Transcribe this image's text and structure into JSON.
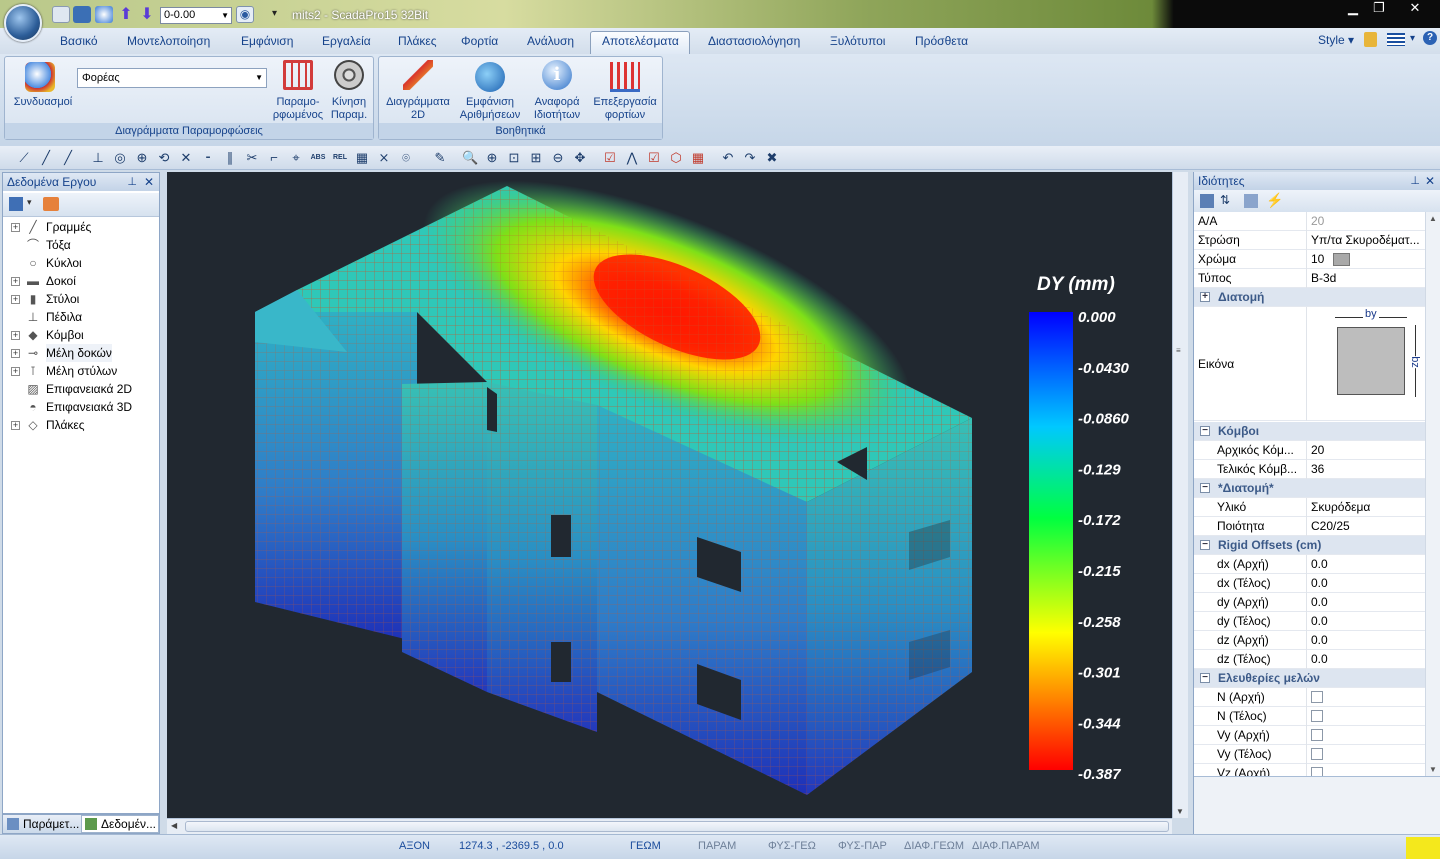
{
  "title_bar": {
    "window_title": "mits2 - ScadaPro15 32Bit",
    "qat_combo_value": "0-0.00"
  },
  "ribbon": {
    "tabs": [
      "Βασικό",
      "Μοντελοποίηση",
      "Εμφάνιση",
      "Εργαλεία",
      "Πλάκες",
      "Φορτία",
      "Ανάλυση",
      "Αποτελέσματα",
      "Διαστασιολόγηση",
      "Ξυλότυποι",
      "Πρόσθετα"
    ],
    "active_tab": "Αποτελέσματα",
    "style_label": "Style",
    "group_deform": {
      "label": "Διαγράμματα Παραμορφώσεις",
      "combinations": "Συνδυασμοί",
      "combo_value": "Φορέας",
      "deformed_line1": "Παραμο-",
      "deformed_line2": "ρφωμένος",
      "motion_line1": "Κίνηση",
      "motion_line2": "Παραμ."
    },
    "group_aux": {
      "label": "Βοηθητικά",
      "diagrams_line1": "Διαγράμματα",
      "diagrams_line2": "2D",
      "numbering_line1": "Εμφάνιση",
      "numbering_line2": "Αριθμήσεων",
      "report_line1": "Αναφορά",
      "report_line2": "Ιδιοτήτων",
      "loads_line1": "Επεξεργασία",
      "loads_line2": "φορτίων"
    }
  },
  "toolbar": {
    "icons": [
      "polyline-icon",
      "line-icon",
      "line-icon",
      "perpendicular-icon",
      "circle-icon",
      "target-icon",
      "rotate-icon",
      "cross-icon",
      "dash-icon",
      "parallel-icon",
      "trim-icon",
      "corner-icon",
      "snap-icon",
      "abs-icon",
      "rel-icon",
      "grid-icon",
      "break-icon",
      "pin-icon",
      "pencil-icon",
      "zoom-icon",
      "zoom-in-icon",
      "zoom-window-icon",
      "zoom-extents-icon",
      "zoom-out-icon",
      "pan-icon",
      "check-icon",
      "chart-icon",
      "check-icon",
      "cube-icon",
      "table-icon",
      "undo-icon",
      "redo-icon",
      "delete-icon"
    ],
    "abs_text": "ABS",
    "rel_text": "REL"
  },
  "left_panel": {
    "title": "Δεδομένα Εργου",
    "tree": [
      {
        "label": "Γραμμές",
        "icon": "line-icon",
        "expandable": true
      },
      {
        "label": "Τόξα",
        "icon": "arc-icon",
        "expandable": false
      },
      {
        "label": "Κύκλοι",
        "icon": "circle-icon",
        "expandable": false
      },
      {
        "label": "Δοκοί",
        "icon": "beam-icon",
        "expandable": true
      },
      {
        "label": "Στύλοι",
        "icon": "column-icon",
        "expandable": true
      },
      {
        "label": "Πέδιλα",
        "icon": "footing-icon",
        "expandable": false
      },
      {
        "label": "Κόμβοι",
        "icon": "node-icon",
        "expandable": true
      },
      {
        "label": "Μέλη δοκών",
        "icon": "beam-member-icon",
        "expandable": true
      },
      {
        "label": "Μέλη στύλων",
        "icon": "column-member-icon",
        "expandable": true
      },
      {
        "label": "Επιφανειακά 2D",
        "icon": "surface-2d-icon",
        "expandable": false
      },
      {
        "label": "Επιφανειακά 3D",
        "icon": "surface-3d-icon",
        "expandable": false
      },
      {
        "label": "Πλάκες",
        "icon": "slab-icon",
        "expandable": true
      }
    ],
    "bottom_tabs": [
      "Παράμετ...",
      "Δεδομέν..."
    ]
  },
  "viewport": {
    "legend_title": "DY (mm)",
    "legend_values": [
      "0.000",
      "-0.0430",
      "-0.0860",
      "-0.129",
      "-0.172",
      "-0.215",
      "-0.258",
      "-0.301",
      "-0.344",
      "-0.387"
    ],
    "colors": {
      "background": "#212830",
      "max": "#0000ff",
      "min": "#ff0000"
    }
  },
  "right_panel": {
    "title": "Ιδιότητες",
    "rows": [
      {
        "type": "row",
        "key": "Α/Α",
        "value": "20",
        "dim": true
      },
      {
        "type": "row",
        "key": "Στρώση",
        "value": "Υπ/τα Σκυροδέματ..."
      },
      {
        "type": "row",
        "key": "Χρώμα",
        "value": "10",
        "swatch": "#a9a9a9"
      },
      {
        "type": "row",
        "key": "Τύπος",
        "value": "B-3d"
      },
      {
        "type": "cat",
        "key": "Διατομή",
        "sign": "+"
      },
      {
        "type": "image",
        "key": "Εικόνα",
        "by": "by",
        "bz": "bz"
      },
      {
        "type": "cat",
        "key": "Κόμβοι",
        "sign": "−"
      },
      {
        "type": "sub",
        "key": "Αρχικός Κόμ...",
        "value": "20"
      },
      {
        "type": "sub",
        "key": "Τελικός Κόμβ...",
        "value": "36"
      },
      {
        "type": "cat",
        "key": "*Διατομή*",
        "sign": "−"
      },
      {
        "type": "sub",
        "key": "Υλικό",
        "value": "Σκυρόδεμα"
      },
      {
        "type": "sub",
        "key": "Ποιότητα",
        "value": "C20/25"
      },
      {
        "type": "cat",
        "key": "Rigid Offsets (cm)",
        "sign": "−"
      },
      {
        "type": "sub",
        "key": "dx (Αρχή)",
        "value": "0.0"
      },
      {
        "type": "sub",
        "key": "dx (Τέλος)",
        "value": "0.0"
      },
      {
        "type": "sub",
        "key": "dy (Αρχή)",
        "value": "0.0"
      },
      {
        "type": "sub",
        "key": "dy (Τέλος)",
        "value": "0.0"
      },
      {
        "type": "sub",
        "key": "dz (Αρχή)",
        "value": "0.0"
      },
      {
        "type": "sub",
        "key": "dz (Τέλος)",
        "value": "0.0"
      },
      {
        "type": "cat",
        "key": "Ελευθερίες μελών",
        "sign": "−"
      },
      {
        "type": "check",
        "key": "N (Αρχή)"
      },
      {
        "type": "check",
        "key": "N (Τέλος)"
      },
      {
        "type": "check",
        "key": "Vy (Αρχή)"
      },
      {
        "type": "check",
        "key": "Vy (Τέλος)"
      },
      {
        "type": "check",
        "key": "Vz (Αρχή)"
      }
    ]
  },
  "status_bar": {
    "axon": "ΑΞΟΝ",
    "coords": "1274.3 , -2369.5 , 0.0",
    "geom": "ΓΕΩΜ",
    "param": "ΠΑΡΑΜ",
    "phys_geo": "ΦΥΣ-ΓΕΩ",
    "phys_par": "ΦΥΣ-ΠΑΡ",
    "diaf_geom": "ΔΙΑΦ.ΓΕΩΜ",
    "diaf_param": "ΔΙΑΦ.ΠΑΡΑΜ"
  }
}
